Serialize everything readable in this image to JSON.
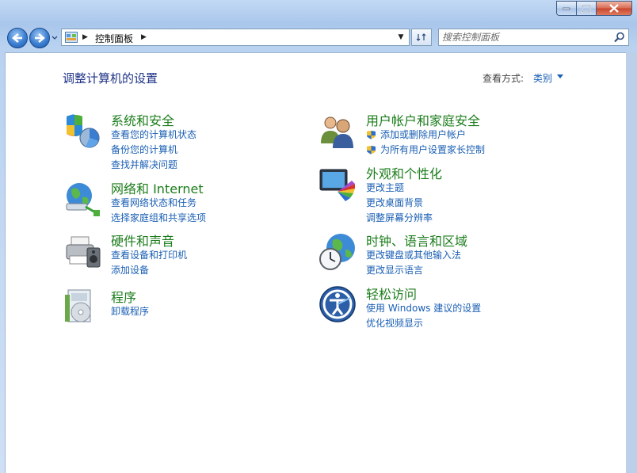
{
  "window": {
    "caption_buttons": [
      "minimize",
      "maximize",
      "close"
    ]
  },
  "navigation": {
    "breadcrumb": "控制面板",
    "search_placeholder": "搜索控制面板"
  },
  "page": {
    "title": "调整计算机的设置",
    "view_by_label": "查看方式:",
    "view_by_value": "类别"
  },
  "categories": {
    "system": {
      "title": "系统和安全",
      "links": [
        "查看您的计算机状态",
        "备份您的计算机",
        "查找并解决问题"
      ]
    },
    "network": {
      "title": "网络和 Internet",
      "links": [
        "查看网络状态和任务",
        "选择家庭组和共享选项"
      ]
    },
    "hardware": {
      "title": "硬件和声音",
      "links": [
        "查看设备和打印机",
        "添加设备"
      ]
    },
    "programs": {
      "title": "程序",
      "links": [
        "卸载程序"
      ]
    },
    "users": {
      "title": "用户帐户和家庭安全",
      "links": [
        "添加或删除用户帐户",
        "为所有用户设置家长控制"
      ]
    },
    "appearance": {
      "title": "外观和个性化",
      "links": [
        "更改主题",
        "更改桌面背景",
        "调整屏幕分辨率"
      ]
    },
    "clock": {
      "title": "时钟、语言和区域",
      "links": [
        "更改键盘或其他输入法",
        "更改显示语言"
      ]
    },
    "ease": {
      "title": "轻松访问",
      "links": [
        "使用 Windows 建议的设置",
        "优化视频显示"
      ]
    }
  },
  "colors": {
    "category_title": "#1c7d1c",
    "link": "#1a5fb4",
    "page_title": "#1e3287"
  }
}
